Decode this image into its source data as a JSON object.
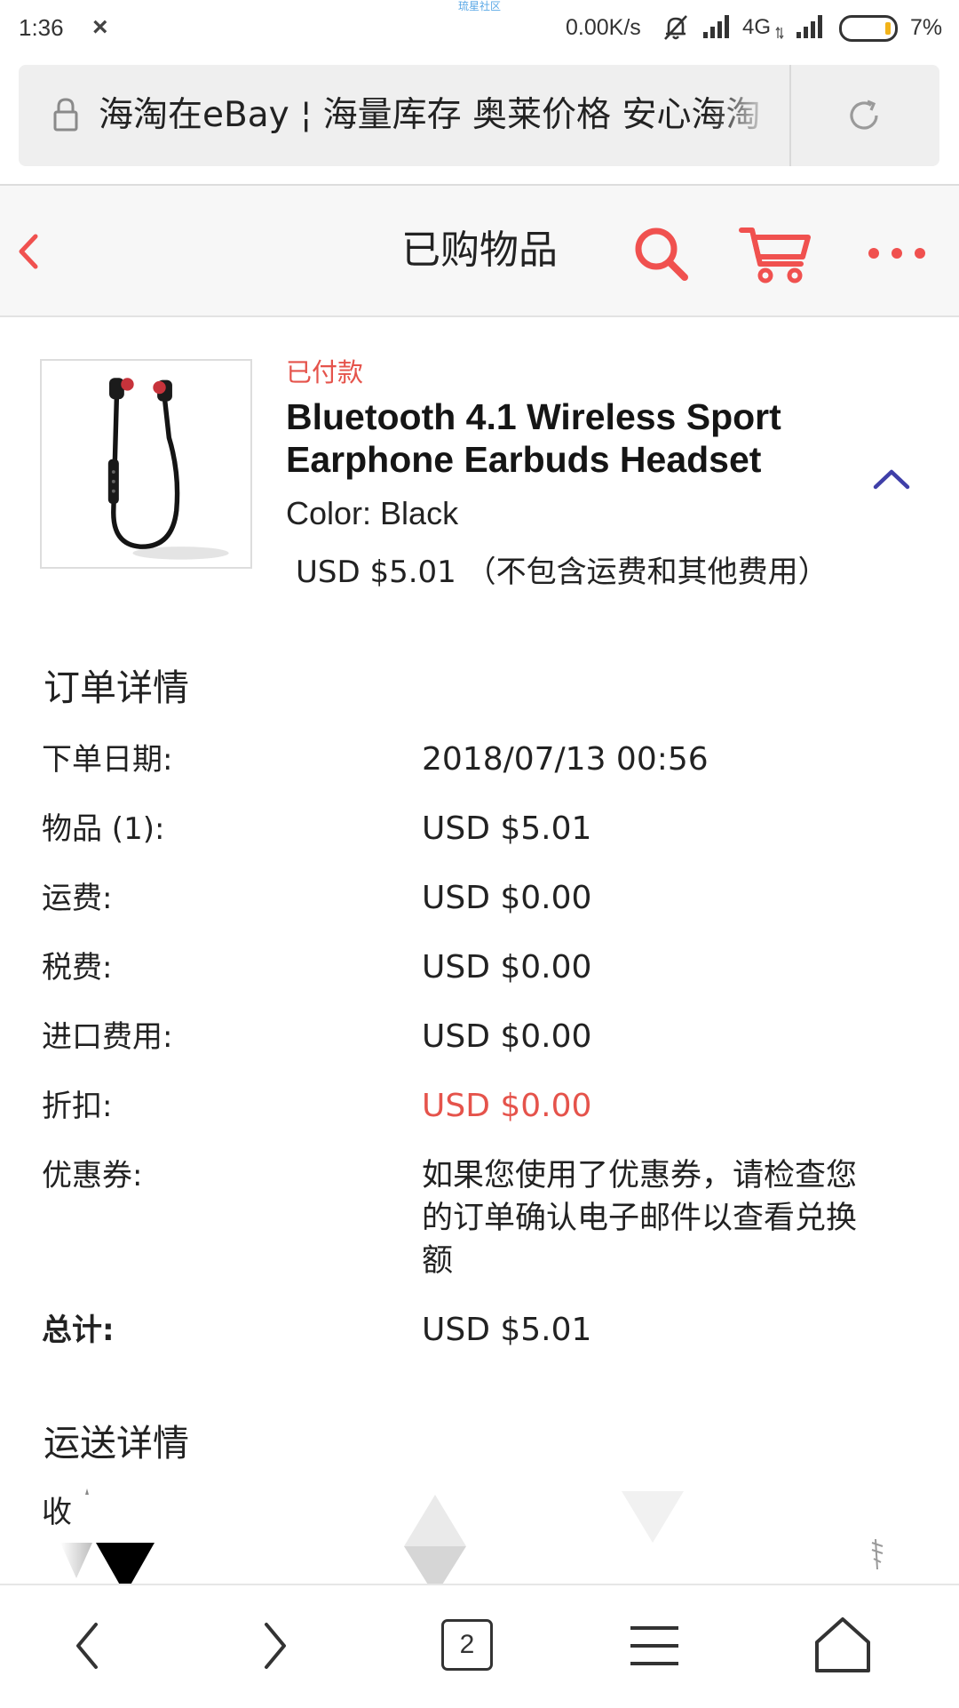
{
  "status_bar": {
    "time": "1:36",
    "close_glyph": "×",
    "watermark": "琉星社区",
    "net_speed": "0.00K/s",
    "network_type": "4G",
    "battery_text": "7%",
    "icons": [
      "mute-bell-icon",
      "signal-icon",
      "signal-icon",
      "battery-icon"
    ]
  },
  "address_bar": {
    "page_title": "海淘在eBay ¦ 海量库存 奥莱价格 安心海淘",
    "lock_icon": "lock-icon",
    "reload_icon": "reload-icon"
  },
  "header": {
    "title": "已购物品",
    "icons": {
      "back": "chevron-left-icon",
      "search": "search-icon",
      "cart": "cart-icon",
      "more": "more-dots-icon"
    }
  },
  "item": {
    "status": "已付款",
    "title": "Bluetooth 4.1 Wireless Sport Earphone Earbuds Headset",
    "color": "Color: Black",
    "price": "USD $5.01 （不包含运费和其他费用）",
    "image_icon": "earphones-product-image",
    "collapse_icon": "chevron-up-icon"
  },
  "order_details": {
    "heading": "订单详情",
    "rows": [
      {
        "label": "下单日期:",
        "value": "2018/07/13 00:56"
      },
      {
        "label": "物品 (1):",
        "value": "USD $5.01"
      },
      {
        "label": "运费:",
        "value": "USD $0.00"
      },
      {
        "label": "税费:",
        "value": "USD $0.00"
      },
      {
        "label": "进口费用:",
        "value": "USD $0.00"
      },
      {
        "label": "折扣:",
        "value": "USD $0.00"
      },
      {
        "label": "优惠券:",
        "value": "如果您使用了优惠券，请检查您的订单确认电子邮件以查看兑换额"
      },
      {
        "label": "总计:",
        "value": "USD $5.01"
      }
    ]
  },
  "shipping_details": {
    "heading": "运送详情",
    "partial_label": "收"
  },
  "bottom_nav": {
    "tab_count": "2",
    "icons": [
      "back-icon",
      "forward-icon",
      "tabs-icon",
      "menu-icon",
      "home-icon"
    ]
  },
  "colors": {
    "accent_red": "#f0514f",
    "status_red": "#e5534b",
    "chevron_indigo": "#3f3fa8",
    "header_bg": "#f7f7f7",
    "address_bg": "#efefef"
  }
}
